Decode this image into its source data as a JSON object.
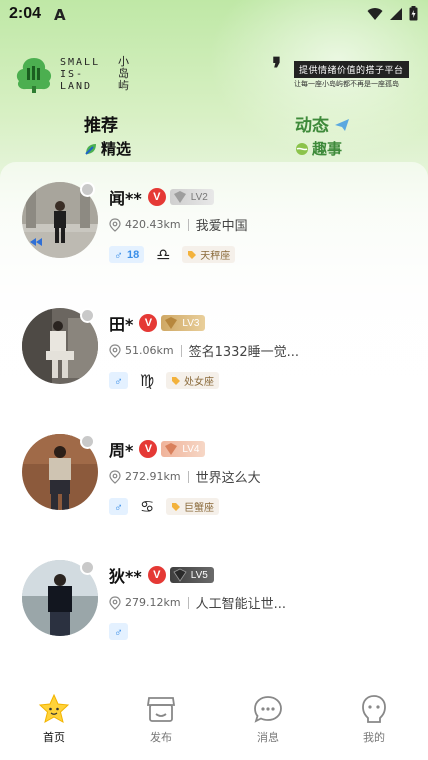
{
  "status_bar": {
    "time": "2:04",
    "app_icon_letter": "A"
  },
  "brand": {
    "logo_en_lines": [
      "SMALL",
      "IS-",
      "LAND"
    ],
    "logo_zh": "小岛屿",
    "slogan_main": "提供情绪价值的搭子平台",
    "slogan_sub": "让每一座小岛屿都不再是一座孤岛"
  },
  "tabs": {
    "recommend": {
      "label": "推荐",
      "sub_label": "精选"
    },
    "dynamic": {
      "label": "动态",
      "sub_label": "趣事"
    }
  },
  "users": [
    {
      "name": "闻**",
      "vip_badge": "V",
      "level": "LV2",
      "level_color": "#c9c9c9",
      "distance": "420.43km",
      "signature": "我爱中国",
      "gender_symbol": "♂",
      "age": "18",
      "zodiac_symbol": "♎",
      "zodiac": "天秤座"
    },
    {
      "name": "田*",
      "vip_badge": "V",
      "level": "LV3",
      "level_color": "#d8b47a",
      "distance": "51.06km",
      "signature": "签名1332睡一觉...",
      "gender_symbol": "♂",
      "age": "",
      "zodiac_symbol": "♍",
      "zodiac": "处女座"
    },
    {
      "name": "周*",
      "vip_badge": "V",
      "level": "LV4",
      "level_color": "#e8a989",
      "distance": "272.91km",
      "signature": "世界这么大",
      "gender_symbol": "♂",
      "age": "",
      "zodiac_symbol": "♋",
      "zodiac": "巨蟹座"
    },
    {
      "name": "狄**",
      "vip_badge": "V",
      "level": "LV5",
      "level_color": "#555555",
      "distance": "279.12km",
      "signature": "人工智能让世...",
      "gender_symbol": "♂",
      "age": "",
      "zodiac_symbol": "",
      "zodiac": ""
    }
  ],
  "nav": {
    "home": "首页",
    "publish": "发布",
    "messages": "消息",
    "mine": "我的"
  },
  "colors": {
    "accent_green": "#3e8a3a",
    "vip_red": "#e53935",
    "gender_blue": "#3b8fe8"
  }
}
